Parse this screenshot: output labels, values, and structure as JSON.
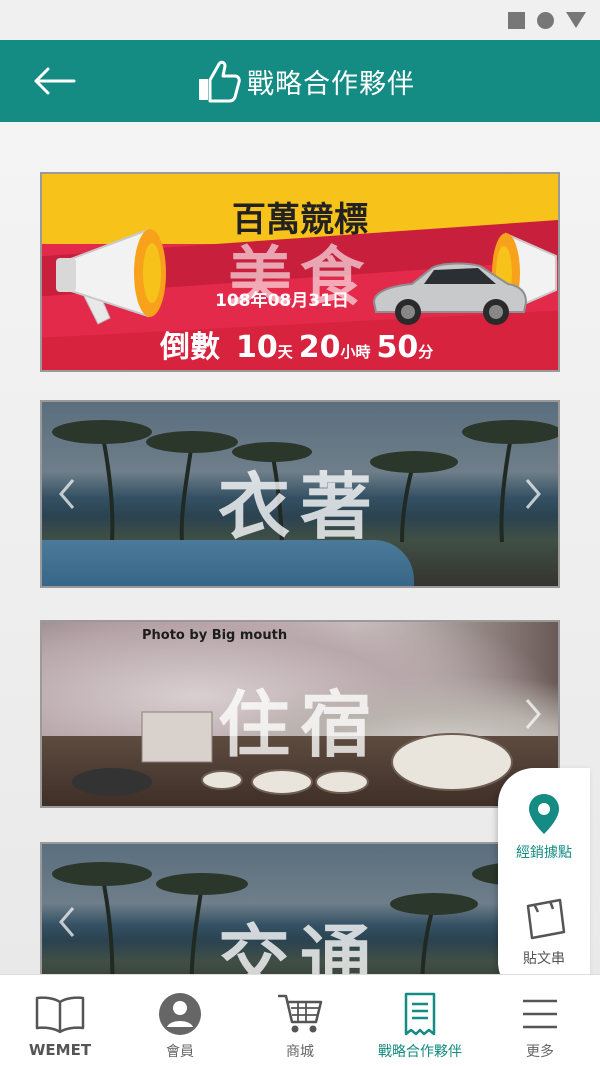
{
  "header": {
    "title": "戰略合作夥伴"
  },
  "banners": [
    {
      "heading": "百萬競標",
      "category": "美食",
      "date": "108年08月31日",
      "countdown": {
        "label": "倒數",
        "days": "10",
        "days_unit": "天",
        "hours": "20",
        "hours_unit": "小時",
        "minutes": "50",
        "minutes_unit": "分"
      }
    },
    {
      "title": "衣著"
    },
    {
      "title": "住宿",
      "credit": "Photo by Big mouth"
    },
    {
      "title": "交通"
    }
  ],
  "side_panel": {
    "dealer_label": "經銷據點",
    "post_label": "貼文串"
  },
  "bottom_nav": [
    {
      "label": "WEMET",
      "icon": "book-icon"
    },
    {
      "label": "會員",
      "icon": "user-icon"
    },
    {
      "label": "商城",
      "icon": "cart-icon"
    },
    {
      "label": "戰略合作夥伴",
      "icon": "receipt-icon",
      "active": true
    },
    {
      "label": "更多",
      "icon": "menu-icon"
    }
  ],
  "colors": {
    "primary": "#148b83",
    "banner_red": "#e32a4a",
    "banner_yellow": "#f7c21a"
  }
}
